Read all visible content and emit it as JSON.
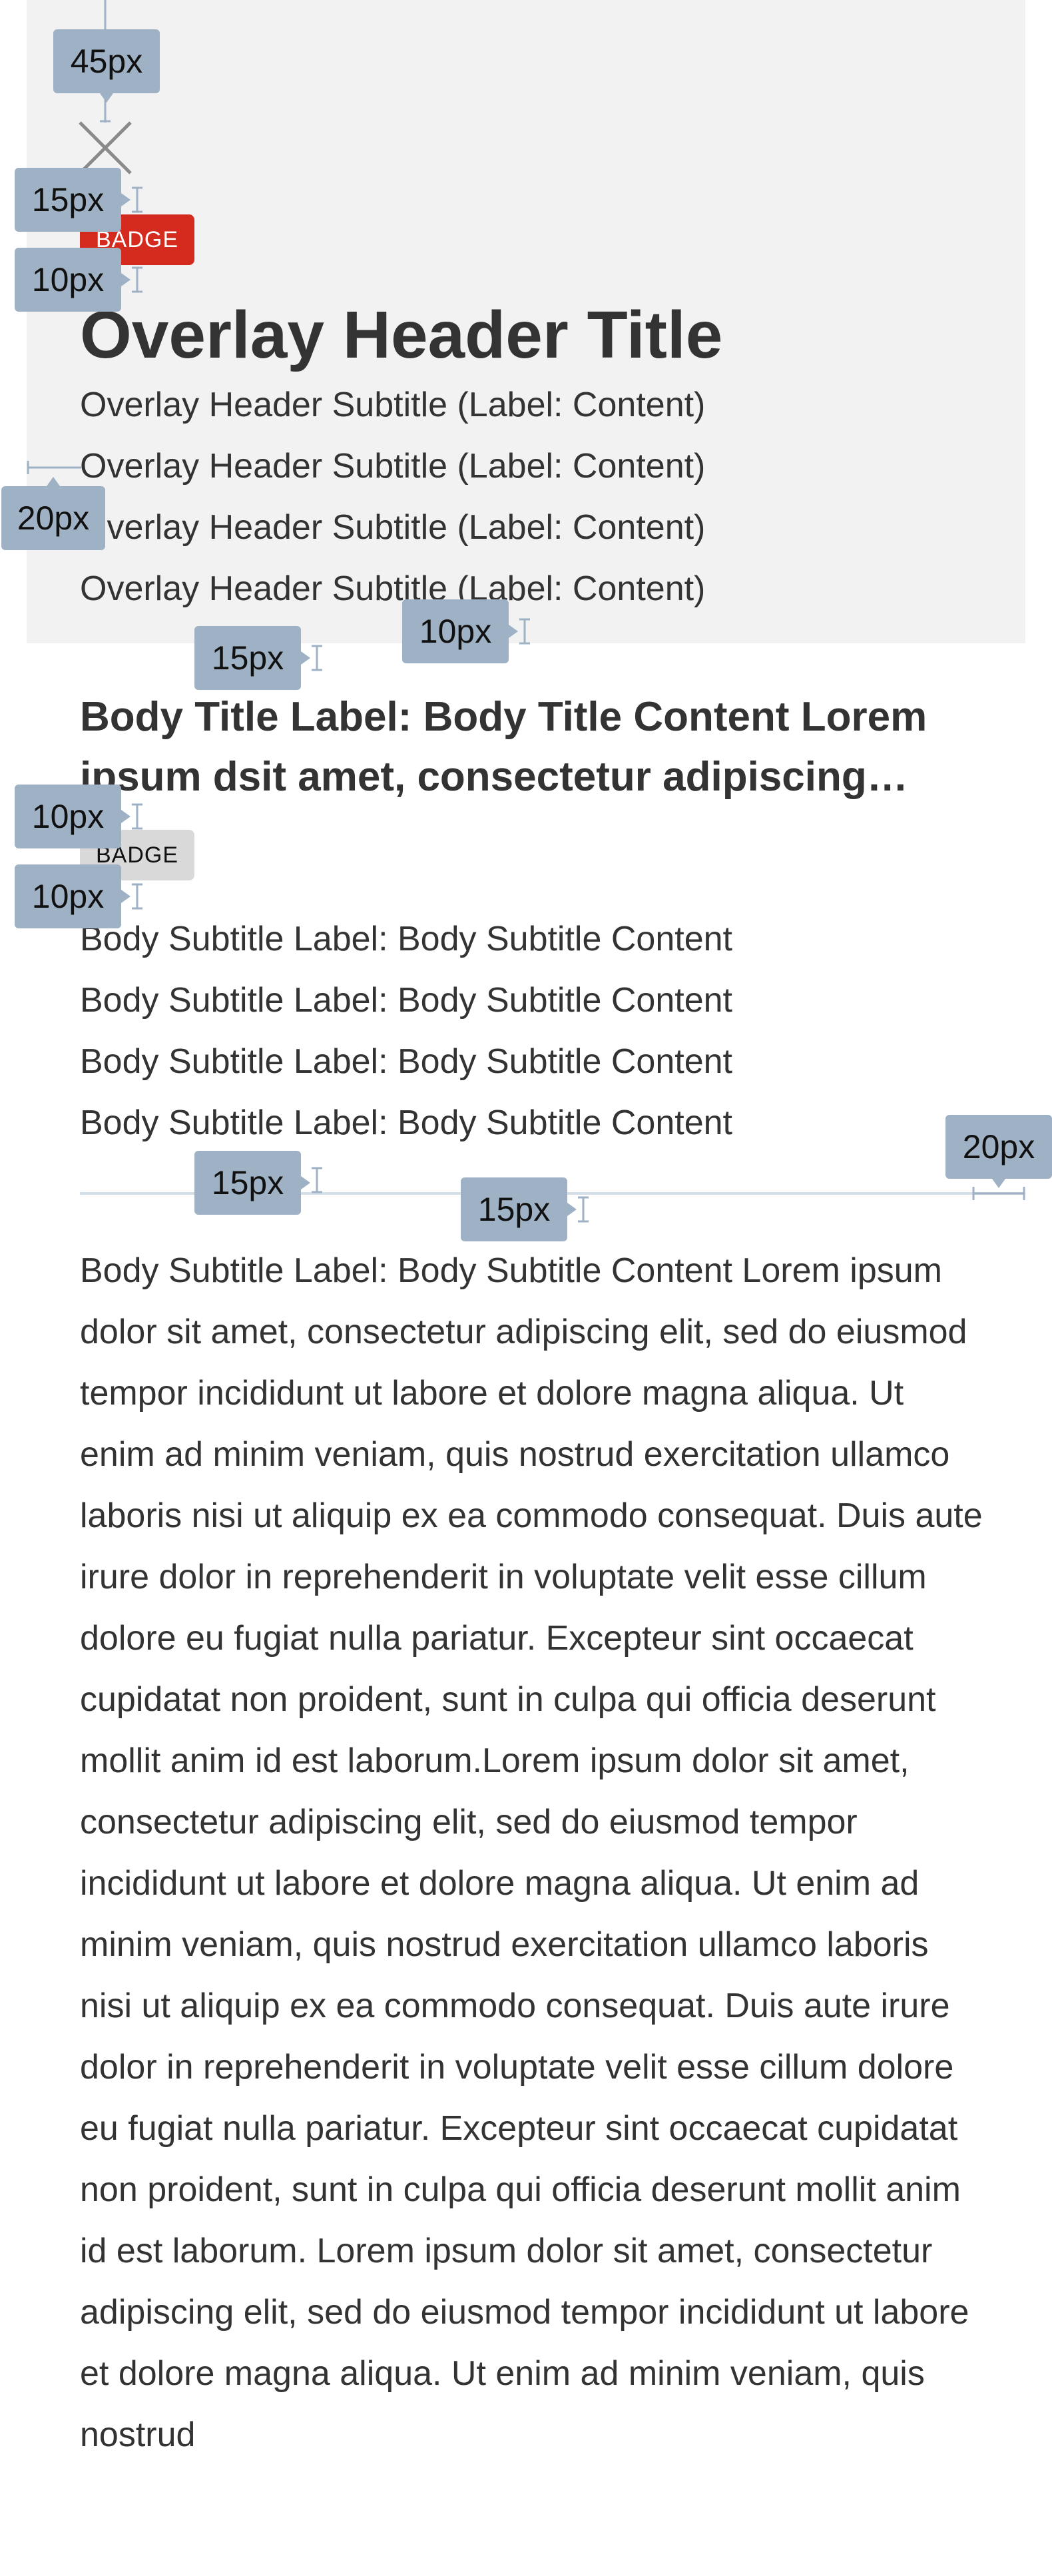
{
  "header": {
    "badge_label": "BADGE",
    "title": "Overlay Header Title",
    "subtitles": [
      "Overlay Header Subtitle (Label: Content)",
      "Overlay Header Subtitle (Label: Content)",
      "Overlay Header Subtitle (Label: Content)",
      "Overlay Header Subtitle (Label: Content)"
    ],
    "close_icon": "close-icon"
  },
  "body": {
    "title": "Body Title Label: Body Title Content Lorem ipsum dsit amet, consectetur adipiscing…",
    "badge_label": "BADGE",
    "subtitles": [
      "Body Subtitle Label: Body Subtitle Content",
      "Body Subtitle Label: Body Subtitle Content",
      "Body Subtitle Label: Body Subtitle Content",
      "Body Subtitle Label: Body Subtitle Content"
    ],
    "paragraph": "Body Subtitle Label: Body Subtitle Content Lorem ipsum dolor sit amet, consectetur adipiscing elit, sed do eiusmod tempor incididunt ut labore et dolore magna aliqua. Ut enim ad minim veniam, quis nostrud exercitation ullamco laboris nisi ut aliquip ex ea commodo consequat. Duis aute irure dolor in reprehenderit in voluptate velit esse cillum dolore eu fugiat nulla pariatur. Excepteur sint occaecat cupidatat non proident, sunt in culpa qui officia deserunt mollit anim id est laborum.Lorem ipsum dolor sit amet, consectetur adipiscing elit, sed do eiusmod tempor incididunt ut labore et dolore magna aliqua. Ut enim ad minim veniam, quis nostrud exercitation ullamco laboris nisi ut aliquip ex ea commodo consequat. Duis aute irure dolor in reprehenderit in voluptate velit esse cillum dolore eu fugiat nulla pariatur. Excepteur sint occaecat cupidatat non proident, sunt in culpa qui officia deserunt mollit anim id est laborum. Lorem ipsum dolor sit amet, consectetur adipiscing elit, sed do eiusmod tempor incididunt ut labore et dolore magna aliqua. Ut enim ad minim veniam, quis nostrud"
  },
  "measurements": {
    "top_spacing": "45px",
    "close_to_badge": "15px",
    "badge_to_title": "10px",
    "left_margin": "20px",
    "header_to_body_title": "15px",
    "subtitle_gap": "10px",
    "title_to_badge": "10px",
    "badge_to_subtitles": "10px",
    "subtitles_to_divider": "15px",
    "divider_to_paragraph": "15px",
    "right_margin": "20px"
  },
  "colors": {
    "header_bg": "#f2f2f2",
    "badge_red": "#d52b1e",
    "badge_grey": "#d9d9d9",
    "measure_tag": "#9fb1c4",
    "divider": "#d5dfe8"
  }
}
